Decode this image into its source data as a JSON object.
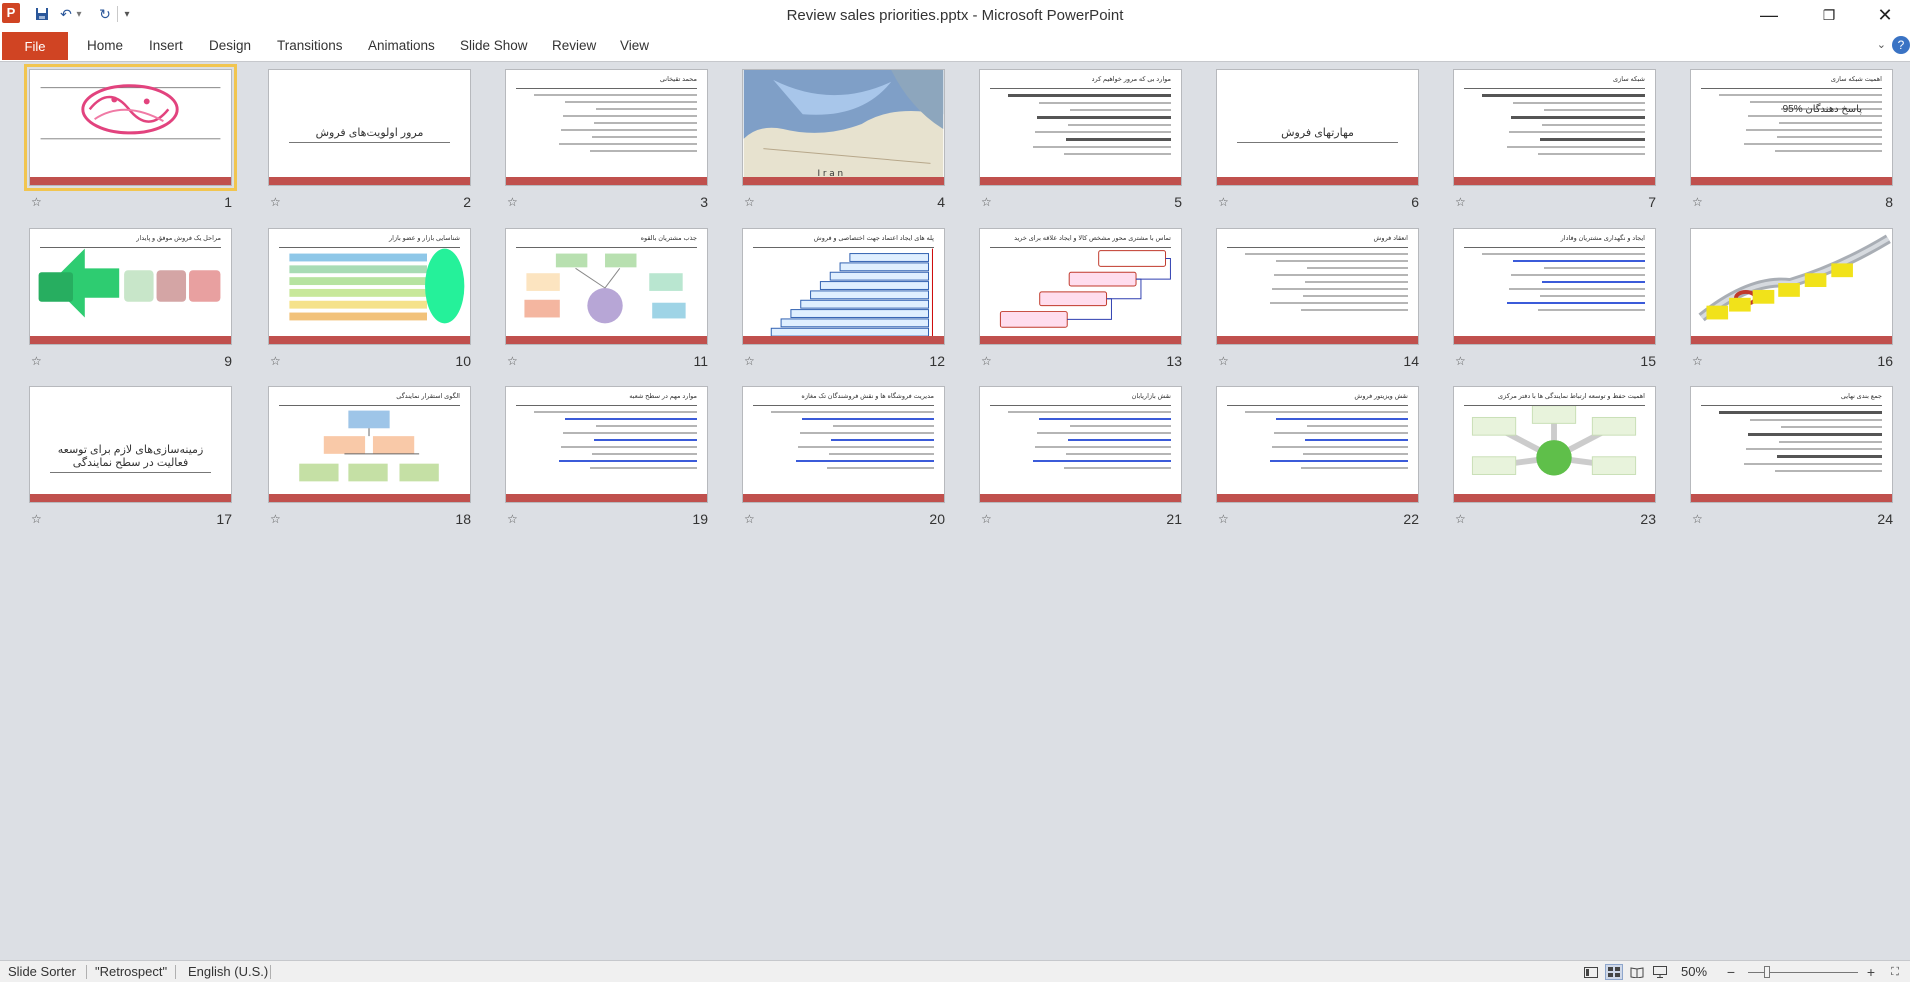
{
  "window": {
    "title": "Review sales priorities.pptx  -  Microsoft PowerPoint",
    "logo": "P",
    "minimize": "—",
    "restore": "❐",
    "close": "✕"
  },
  "qat": {
    "save_icon": "💾",
    "undo_icon": "↶",
    "undo_dropdown": "▾",
    "redo_icon": "↻",
    "customize": "▾"
  },
  "ribbon": {
    "file": "File",
    "tabs": [
      "Home",
      "Insert",
      "Design",
      "Transitions",
      "Animations",
      "Slide Show",
      "Review",
      "View"
    ],
    "collapse": "⌄",
    "help": "?"
  },
  "slides": [
    {
      "num": "1",
      "title": "",
      "center": "",
      "kind": "calligraphy"
    },
    {
      "num": "2",
      "title": "",
      "center": "مرور اولویت‌های فروش",
      "kind": "title"
    },
    {
      "num": "3",
      "title": "محمد تقیخانی",
      "center": "",
      "kind": "text"
    },
    {
      "num": "4",
      "title": "",
      "center": "I r a n",
      "kind": "map"
    },
    {
      "num": "5",
      "title": "موارد بی که مرور خواهیم کرد",
      "center": "",
      "kind": "textdark"
    },
    {
      "num": "6",
      "title": "",
      "center": "مهارتهای فروش",
      "kind": "title"
    },
    {
      "num": "7",
      "title": "شبکه سازی",
      "center": "",
      "kind": "textdark"
    },
    {
      "num": "8",
      "title": "اهمیت شبکه سازی",
      "center": "95% پاسخ دهندگان",
      "kind": "text8"
    },
    {
      "num": "9",
      "title": "مراحل یک فروش موفق و پایدار",
      "center": "",
      "kind": "arrows"
    },
    {
      "num": "10",
      "title": "شناسایی بازار و عضو بازار",
      "center": "",
      "kind": "bars"
    },
    {
      "num": "11",
      "title": "جذب مشتریان بالقوه",
      "center": "",
      "kind": "hub"
    },
    {
      "num": "12",
      "title": "پله های ایجاد اعتماد جهت اختصاصی و فروش",
      "center": "",
      "kind": "stairs"
    },
    {
      "num": "13",
      "title": "تماس با مشتری محور مشخص کالا و ایجاد علاقه برای خرید",
      "center": "",
      "kind": "flow"
    },
    {
      "num": "14",
      "title": "انعقاد فروش",
      "center": "",
      "kind": "text"
    },
    {
      "num": "15",
      "title": "ایجاد و نگهداری مشتریان وفادار",
      "center": "",
      "kind": "textblue"
    },
    {
      "num": "16",
      "title": "",
      "center": "",
      "kind": "chain"
    },
    {
      "num": "17",
      "title": "",
      "center": "زمینه‌سازی‌های لازم برای توسعه فعالیت در سطح نمایندگی",
      "kind": "title"
    },
    {
      "num": "18",
      "title": "الگوی استقرار نمایندگی",
      "center": "",
      "kind": "org"
    },
    {
      "num": "19",
      "title": "موارد مهم در سطح شعبه",
      "center": "",
      "kind": "textblue"
    },
    {
      "num": "20",
      "title": "مدیریت فروشگاه ها و نقش فروشندگان تک مغازه",
      "center": "",
      "kind": "textblue"
    },
    {
      "num": "21",
      "title": "نقش بازاریابان",
      "center": "",
      "kind": "textblue"
    },
    {
      "num": "22",
      "title": "نقش ویزیتور فروش",
      "center": "",
      "kind": "textblue"
    },
    {
      "num": "23",
      "title": "اهمیت حفظ و توسعه ارتباط نمایندگی ها با دفتر مرکزی",
      "center": "",
      "kind": "radial"
    },
    {
      "num": "24",
      "title": "جمع بندی نهایی",
      "center": "",
      "kind": "textdark"
    }
  ],
  "status": {
    "view": "Slide Sorter",
    "theme": "\"Retrospect\"",
    "language": "English (U.S.)",
    "zoom": "50%",
    "zoom_out": "−",
    "zoom_in": "+",
    "fit_icon": "⛶"
  }
}
